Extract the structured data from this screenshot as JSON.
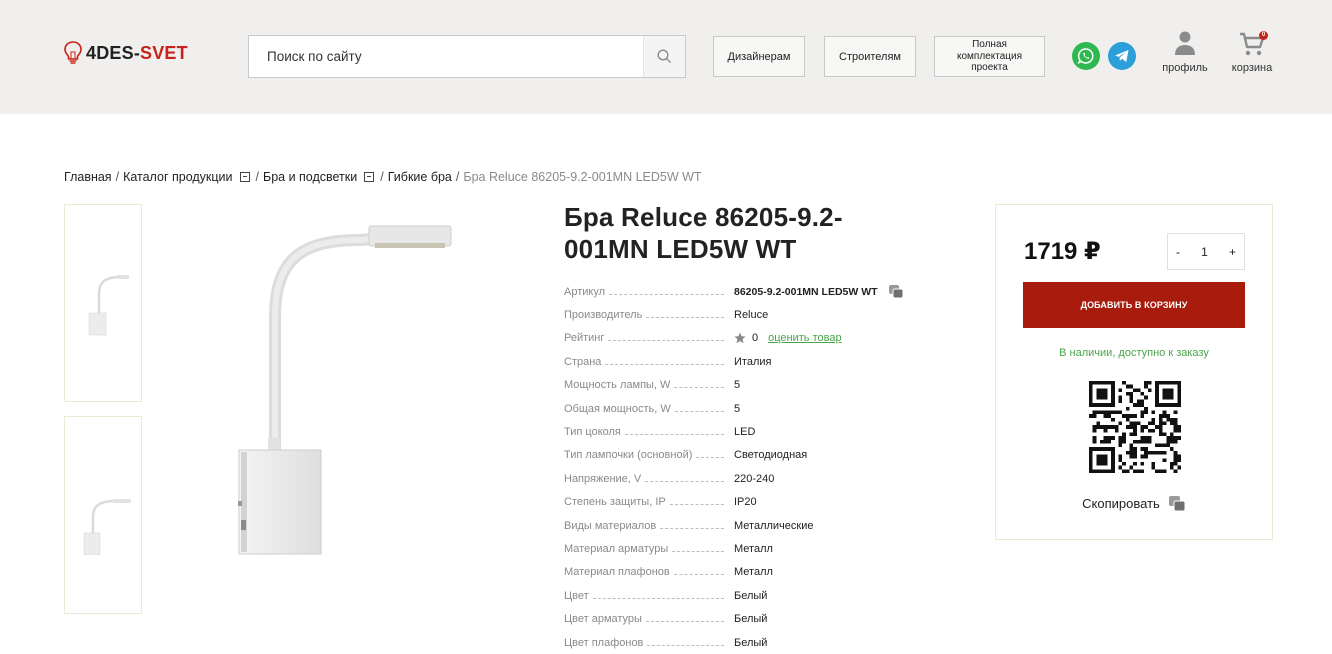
{
  "header": {
    "logo": {
      "part1": "4DES-",
      "part2": "SVET"
    },
    "search": {
      "placeholder": "Поиск по сайту"
    },
    "nav": [
      "Дизайнерам",
      "Строителям",
      "Полная комплектация проекта"
    ],
    "profile_label": "профиль",
    "cart_label": "корзина",
    "cart_count": "0"
  },
  "breadcrumb": {
    "items": [
      "Главная",
      "Каталог продукции",
      "Бра и подсветки",
      "Гибкие бра"
    ],
    "current": "Бра Reluce 86205-9.2-001MN LED5W WT"
  },
  "product": {
    "title": "Бра Reluce 86205-9.2-001MN LED5W WT",
    "specs": [
      {
        "label": "Артикул",
        "value": "86205-9.2-001MN LED5W WT"
      },
      {
        "label": "Производитель",
        "value": "Reluce"
      },
      {
        "label": "Рейтинг",
        "value": "0",
        "link": "оценить товар"
      },
      {
        "label": "Страна",
        "value": "Италия"
      },
      {
        "label": "Мощность лампы, W",
        "value": "5"
      },
      {
        "label": "Общая мощность, W",
        "value": "5"
      },
      {
        "label": "Тип цоколя",
        "value": "LED"
      },
      {
        "label": "Тип лампочки (основной)",
        "value": "Светодиодная"
      },
      {
        "label": "Напряжение, V",
        "value": "220-240"
      },
      {
        "label": "Степень защиты, IP",
        "value": "IP20"
      },
      {
        "label": "Виды материалов",
        "value": "Металлические"
      },
      {
        "label": "Материал арматуры",
        "value": "Металл"
      },
      {
        "label": "Материал плафонов",
        "value": "Металл"
      },
      {
        "label": "Цвет",
        "value": "Белый"
      },
      {
        "label": "Цвет арматуры",
        "value": "Белый"
      },
      {
        "label": "Цвет плафонов",
        "value": "Белый"
      }
    ]
  },
  "buybox": {
    "price": "1719 ₽",
    "qty": {
      "minus": "-",
      "value": "1",
      "plus": "+"
    },
    "add_to_cart": "ДОБАВИТЬ В КОРЗИНУ",
    "stock": "В наличии, доступно к заказу",
    "copy": "Скопировать"
  },
  "colors": {
    "brand_red": "#c8231a",
    "button_red": "#a81c0e",
    "stock_green": "#4aa44a",
    "whatsapp": "#2fb84f",
    "telegram": "#2a9fd9"
  },
  "icons": [
    "bulb-icon",
    "search-icon",
    "whatsapp-icon",
    "telegram-icon",
    "profile-icon",
    "cart-icon",
    "dropdown-icon",
    "copy-icon",
    "star-icon",
    "qr-code"
  ]
}
